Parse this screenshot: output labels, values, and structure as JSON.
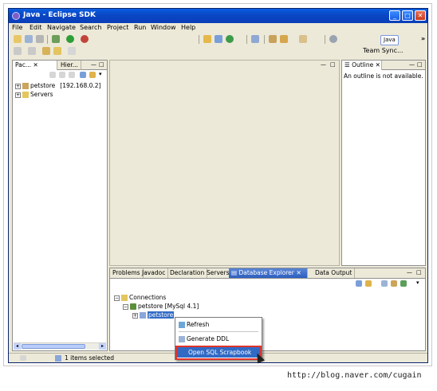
{
  "window": {
    "title": "Java - Eclipse SDK",
    "minimize_glyph": "_",
    "maximize_glyph": "□",
    "close_glyph": "✕"
  },
  "menu": [
    "File",
    "Edit",
    "Navigate",
    "Search",
    "Project",
    "Run",
    "Window",
    "Help"
  ],
  "perspective": {
    "java_label": "Java",
    "team_sync_label": "Team Sync...",
    "more_glyph": "»"
  },
  "package_explorer": {
    "tabs": [
      {
        "label": "Pac...",
        "closable": true
      },
      {
        "label": "Hier..."
      }
    ],
    "tree": [
      {
        "label": "petstore",
        "suffix": "[192.168.0.2]"
      },
      {
        "label": "Servers"
      }
    ]
  },
  "outline": {
    "tab_label": "Outline",
    "message": "An outline is not available."
  },
  "bottom_panel": {
    "tabs": [
      "Problems",
      "Javadoc",
      "Declaration",
      "Servers",
      "Database Explorer",
      "Data Output"
    ],
    "active_tab": "Database Explorer",
    "tree": {
      "root": "Connections",
      "connection": "petstore [MySql 4.1]",
      "database": "petstore"
    }
  },
  "context_menu": {
    "items": [
      "Refresh",
      "Generate DDL",
      "Open SQL Scrapbook"
    ],
    "selected": "Open SQL Scrapbook"
  },
  "statusbar": {
    "text": "1 items selected"
  },
  "watermark": "http://blog.naver.com/cugain",
  "colors": {
    "title_bar": "#0a46c4",
    "active_tab": "#2d5fbf",
    "selection": "#316ac5",
    "highlight_box": "#e0332a"
  }
}
